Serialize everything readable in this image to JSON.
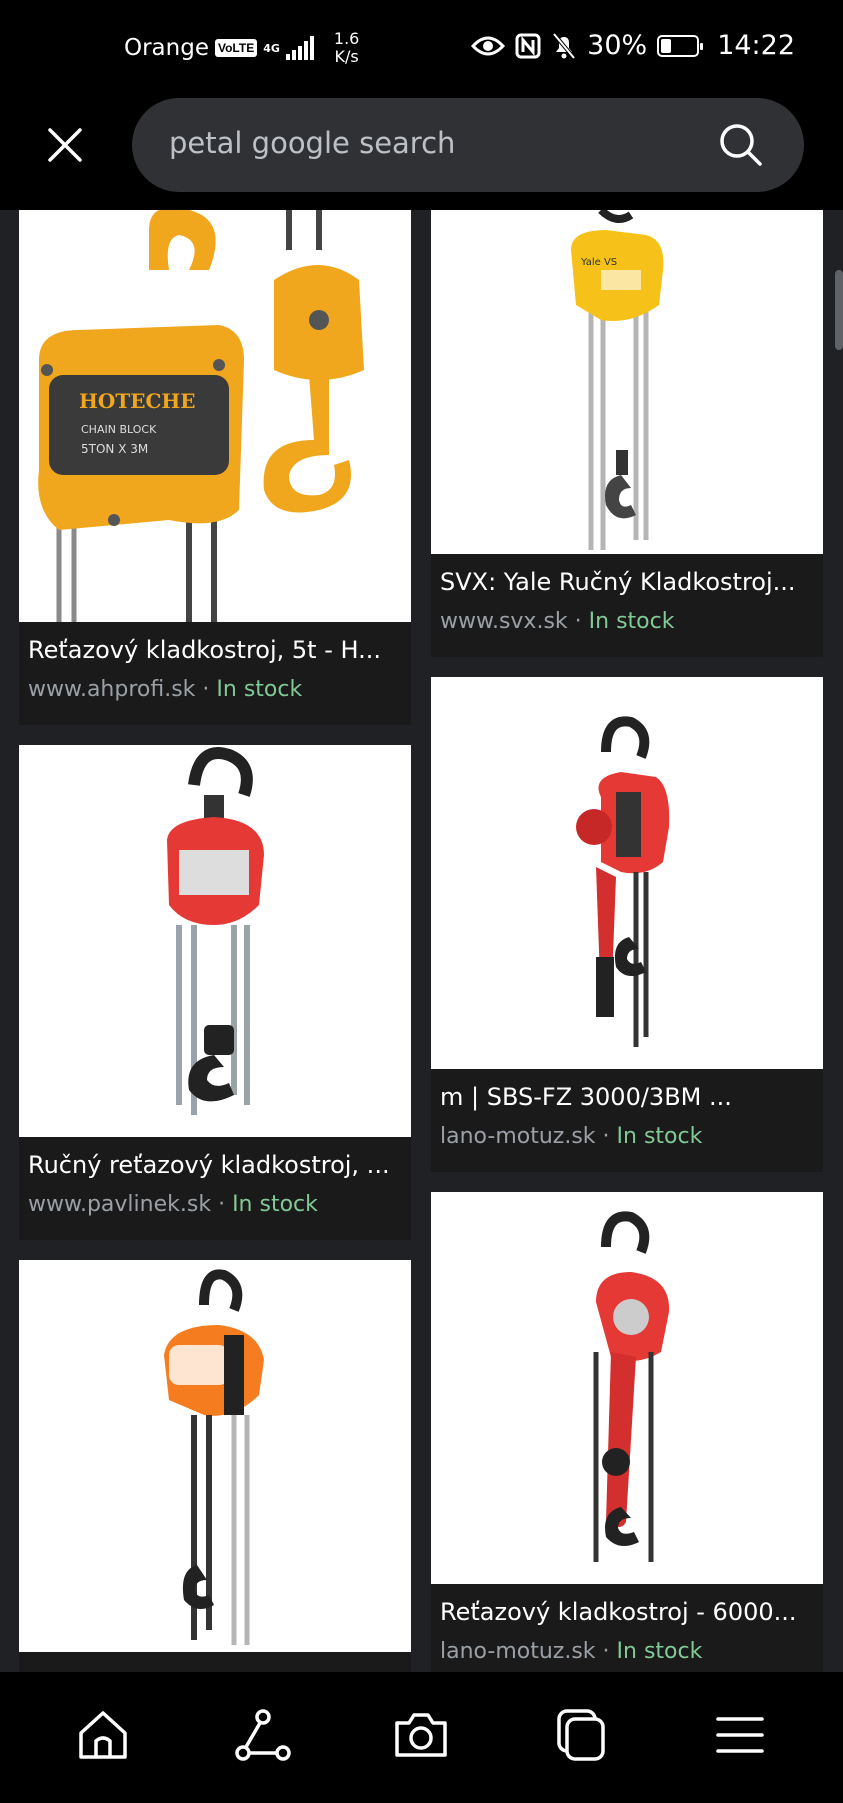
{
  "status_bar": {
    "carrier": "Orange",
    "volte": "VoLTE",
    "network": "4G",
    "speed_value": "1.6",
    "speed_unit": "K/s",
    "battery": "30%",
    "battery_level": 0.3,
    "time": "14:22"
  },
  "search": {
    "query": "petal google search"
  },
  "results": [
    {
      "title": "Reťazový kladkostroj, 5t - H...",
      "source": "www.ahprofi.sk",
      "separator": "·",
      "stock": "In stock"
    },
    {
      "title": "SVX: Yale Ručný Kladkostroj...",
      "source": "www.svx.sk",
      "separator": "·",
      "stock": "In stock"
    },
    {
      "title": "Ručný reťazový kladkostroj, ...",
      "source": "www.pavlinek.sk",
      "separator": "·",
      "stock": "In stock"
    },
    {
      "title": "m | SBS-FZ 3000/3BM ...",
      "source": "lano-motuz.sk",
      "separator": "·",
      "stock": "In stock"
    },
    {
      "title": "Reťazový kladkostroj - 6000...",
      "source": "lano-motuz.sk",
      "separator": "·",
      "stock": "In stock"
    }
  ],
  "nav": [
    "home-icon",
    "share-icon",
    "camera-icon",
    "tabs-icon",
    "menu-icon"
  ]
}
